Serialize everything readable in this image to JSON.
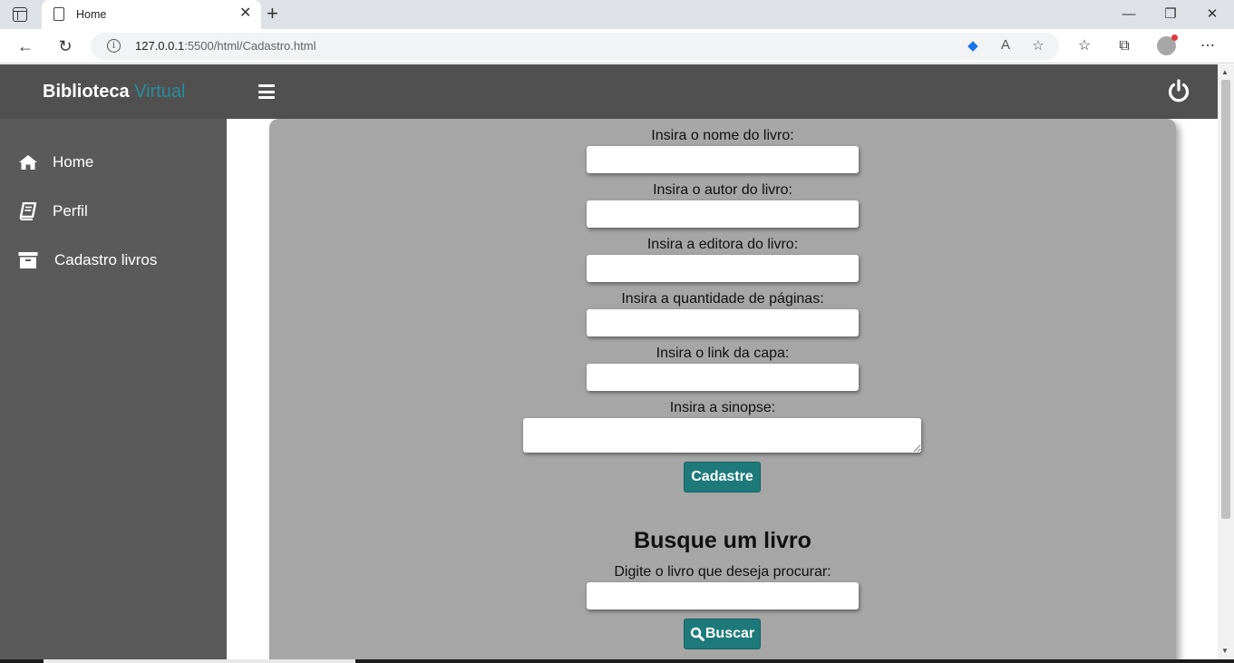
{
  "browser": {
    "tab_title": "Home",
    "url_host": "127.0.0.1",
    "url_rest": ":5500/html/Cadastro.html"
  },
  "header": {
    "brand_main": "Biblioteca",
    "brand_accent": "Virtual"
  },
  "sidebar": {
    "items": [
      {
        "label": "Home",
        "icon": "home-icon"
      },
      {
        "label": "Perfil",
        "icon": "book-icon"
      },
      {
        "label": "Cadastro livros",
        "icon": "archive-icon"
      }
    ]
  },
  "form": {
    "fields": [
      {
        "label": "Insira o nome do livro:",
        "value": ""
      },
      {
        "label": "Insira o autor do livro:",
        "value": ""
      },
      {
        "label": "Insira a editora do livro:",
        "value": ""
      },
      {
        "label": "Insira a quantidade de páginas:",
        "value": ""
      },
      {
        "label": "Insira o link da capa:",
        "value": ""
      },
      {
        "label": "Insira a sinopse:",
        "value": ""
      }
    ],
    "submit_label": "Cadastre"
  },
  "search": {
    "title": "Busque um livro",
    "label": "Digite o livro que deseja procurar:",
    "value": "",
    "button_label": "Buscar"
  },
  "colors": {
    "header_bg": "#505050",
    "sidebar_bg": "#5a5a5a",
    "content_bg": "#a6a6a6",
    "accent": "#2a8d9a",
    "button_bg": "#1e7a7a"
  }
}
